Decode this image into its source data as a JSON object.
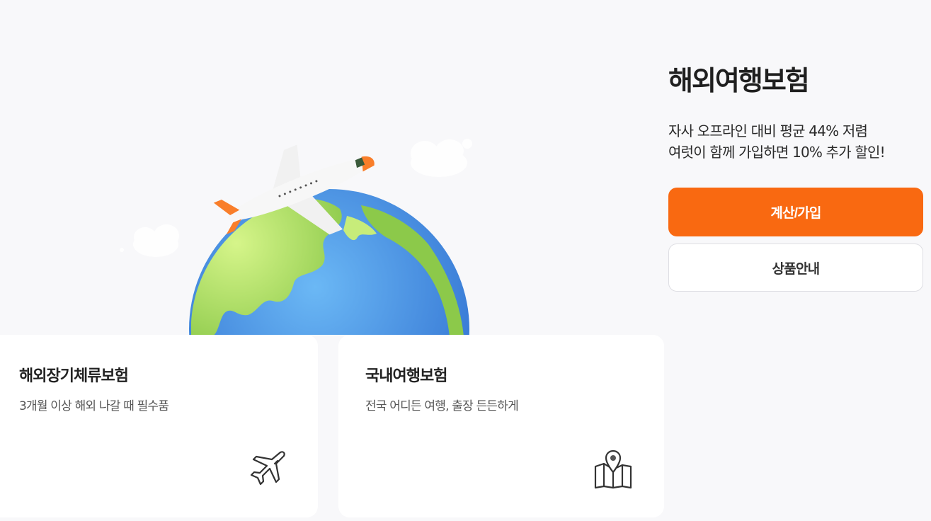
{
  "product": {
    "title": "해외여행보험",
    "desc_line1": "자사 오프라인 대비 평균 44% 저렴",
    "desc_line2": "여럿이 함께 가입하면 10% 추가 할인!",
    "primary_button": "계산/가입",
    "secondary_button": "상품안내"
  },
  "cards": [
    {
      "title": "해외장기체류보험",
      "subtitle": "3개월 이상 해외 나갈 때 필수품",
      "icon": "airplane-icon"
    },
    {
      "title": "국내여행보험",
      "subtitle": "전국 어디든 여행, 출장 든든하게",
      "icon": "map-pin-icon"
    }
  ],
  "colors": {
    "accent": "#f96911",
    "background": "#f8f8fa",
    "card": "#ffffff"
  }
}
